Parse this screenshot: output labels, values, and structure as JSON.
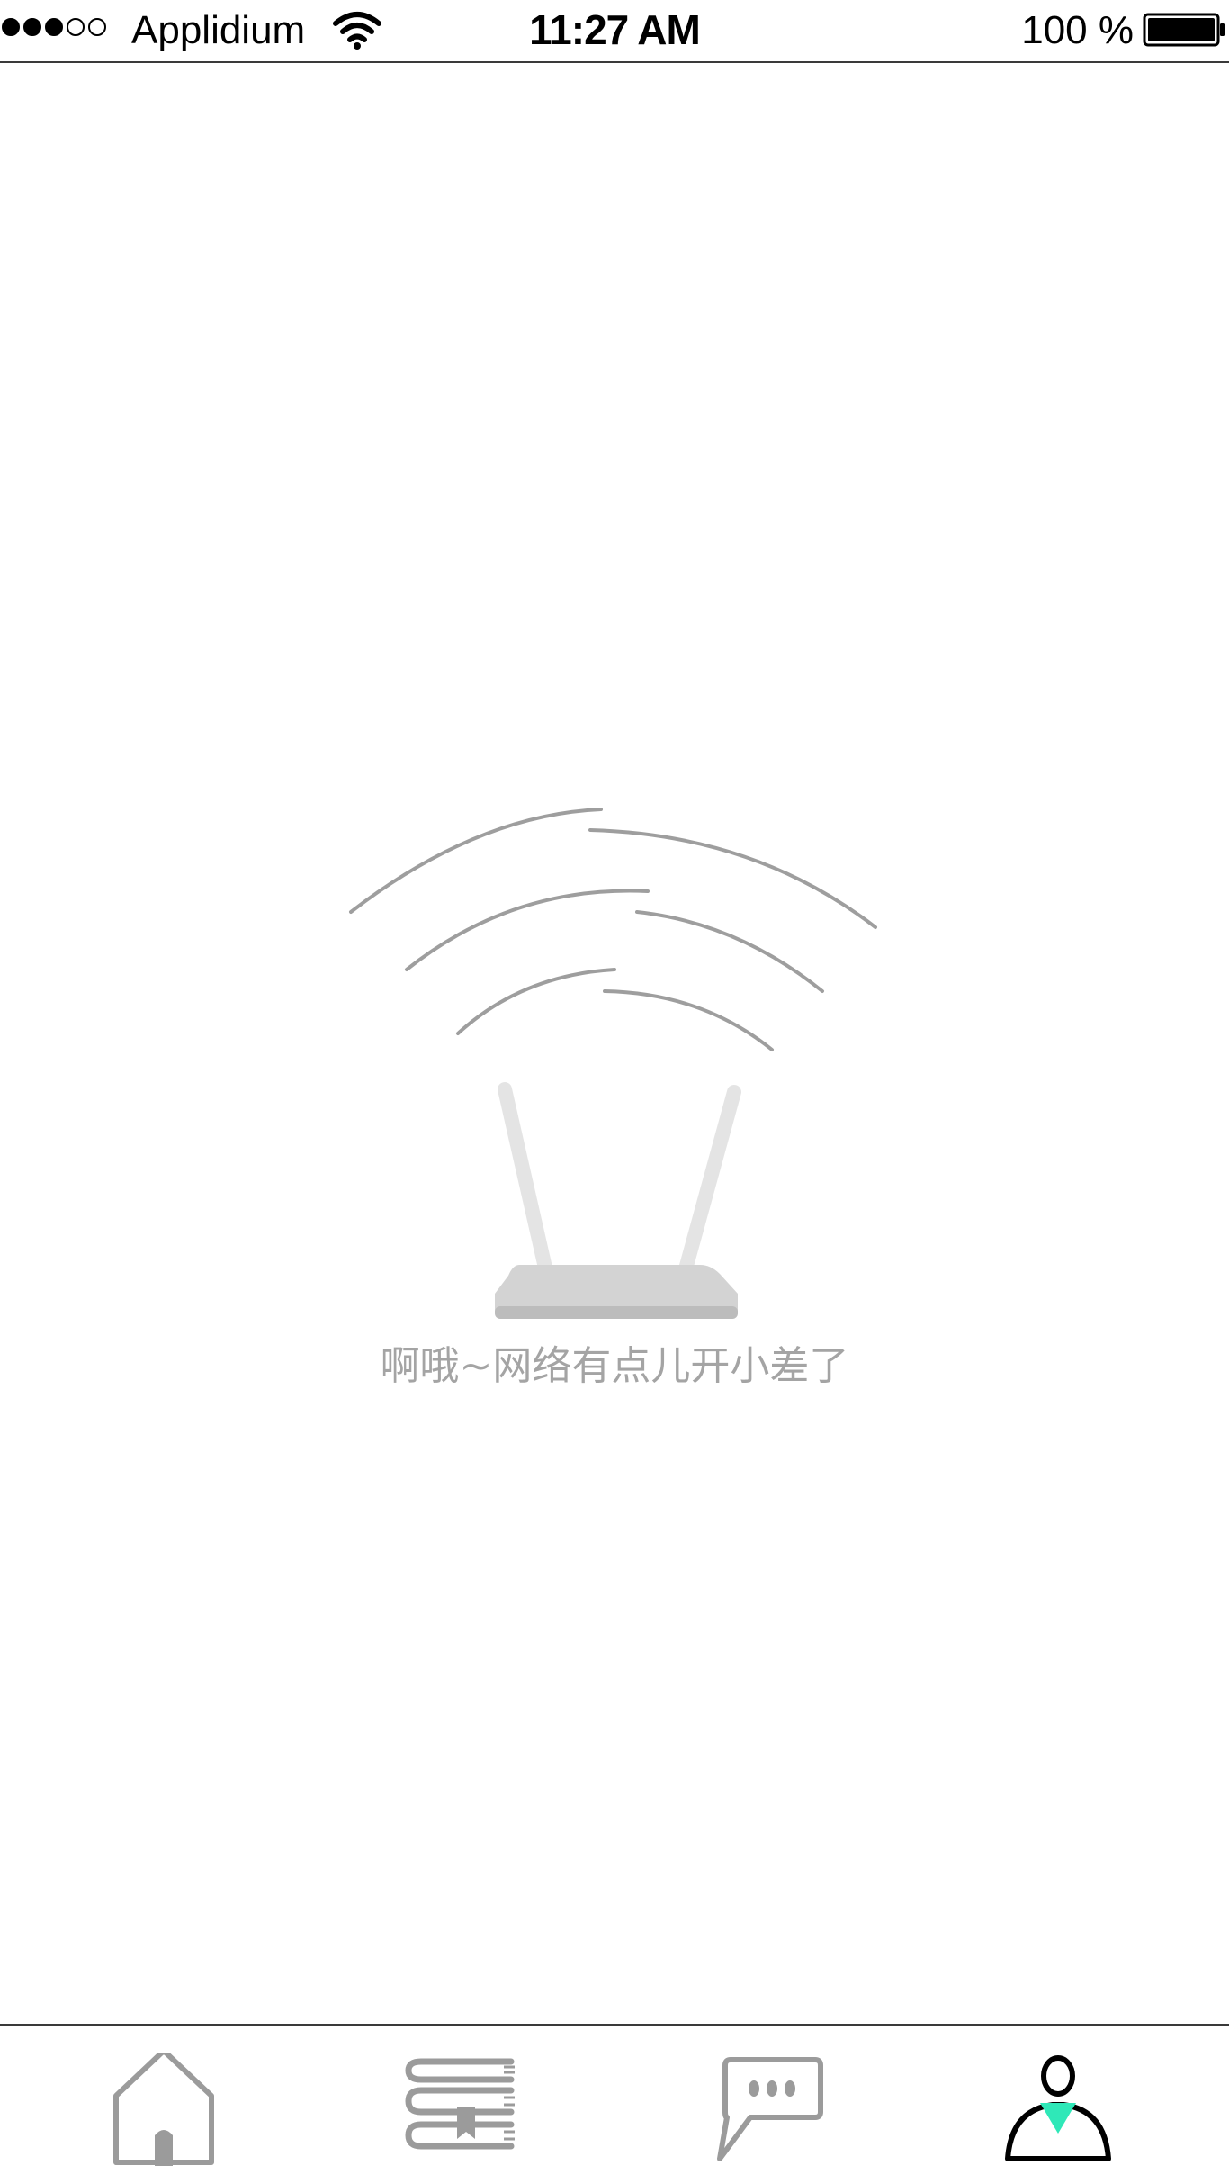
{
  "status_bar": {
    "signal_filled": 3,
    "signal_total": 5,
    "carrier": "Applidium",
    "wifi_icon": "wifi-icon",
    "time": "11:27 AM",
    "battery_label": "100 %",
    "battery_level": 1.0,
    "battery_icon": "battery-icon"
  },
  "main": {
    "illustration_icon": "router-signal-icon",
    "error_message": "啊哦~网络有点儿开小差了"
  },
  "tab_bar": {
    "active_tab": "profile",
    "accent_color": "#2fe8b8",
    "inactive_color": "#9b9b9b",
    "tabs": [
      {
        "id": "home",
        "icon": "home-icon"
      },
      {
        "id": "library",
        "icon": "books-icon"
      },
      {
        "id": "messages",
        "icon": "chat-bubble-icon"
      },
      {
        "id": "profile",
        "icon": "person-icon"
      }
    ]
  }
}
